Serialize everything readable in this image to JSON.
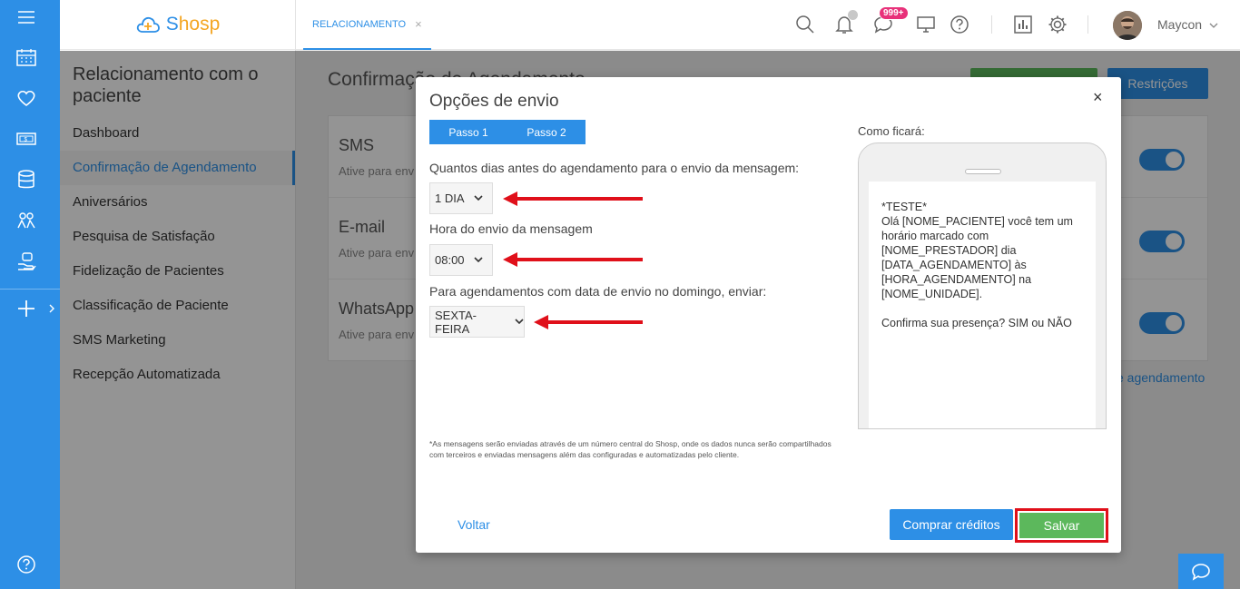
{
  "brand": {
    "name_part1": "S",
    "name_part2": "hosp"
  },
  "sidebar": {
    "title": "Relacionamento com o paciente",
    "items": [
      {
        "label": "Dashboard"
      },
      {
        "label": "Confirmação de Agendamento"
      },
      {
        "label": "Aniversários"
      },
      {
        "label": "Pesquisa de Satisfação"
      },
      {
        "label": "Fidelização de Pacientes"
      },
      {
        "label": "Classificação de Paciente"
      },
      {
        "label": "SMS Marketing"
      },
      {
        "label": "Recepção Automatizada"
      }
    ]
  },
  "topbar": {
    "tab_label": "RELACIONAMENTO",
    "tab_close": "×",
    "messages_badge": "999+",
    "user_name": "Maycon"
  },
  "background": {
    "page_title": "Confirmação de Agendamento",
    "restricoes_label": "Restrições",
    "rows": [
      {
        "title": "SMS",
        "subtitle": "Ative para env"
      },
      {
        "title": "E-mail",
        "subtitle": "Ative para env"
      },
      {
        "title": "WhatsApp",
        "subtitle": "Ative para env"
      }
    ],
    "link_text": "e agendamento"
  },
  "modal": {
    "title": "Opções de envio",
    "close": "×",
    "steps": [
      "Passo 1",
      "Passo 2"
    ],
    "q1_label": "Quantos dias antes do agendamento para o envio da mensagem:",
    "q1_value": "1 DIA",
    "q2_label": "Hora do envio da mensagem",
    "q2_value": "08:00",
    "q3_label": "Para agendamentos com data de envio no domingo, enviar:",
    "q3_value": "SEXTA-FEIRA",
    "footnote": "*As mensagens serão enviadas através de um número central do Shosp, onde os dados nunca serão compartilhados com terceiros e enviadas mensagens além das configuradas e automatizadas pelo cliente.",
    "preview_label": "Como ficará:",
    "preview_text": "*TESTE*\nOlá [NOME_PACIENTE] você tem um horário marcado com [NOME_PRESTADOR] dia [DATA_AGENDAMENTO] às [HORA_AGENDAMENTO] na [NOME_UNIDADE].\n\nConfirma sua presença? SIM ou NÃO",
    "back_label": "Voltar",
    "buy_label": "Comprar créditos",
    "save_label": "Salvar"
  },
  "colors": {
    "primary": "#2d8fe6",
    "success": "#5cb85c",
    "highlight": "#e0101a",
    "badge": "#e8317a"
  }
}
